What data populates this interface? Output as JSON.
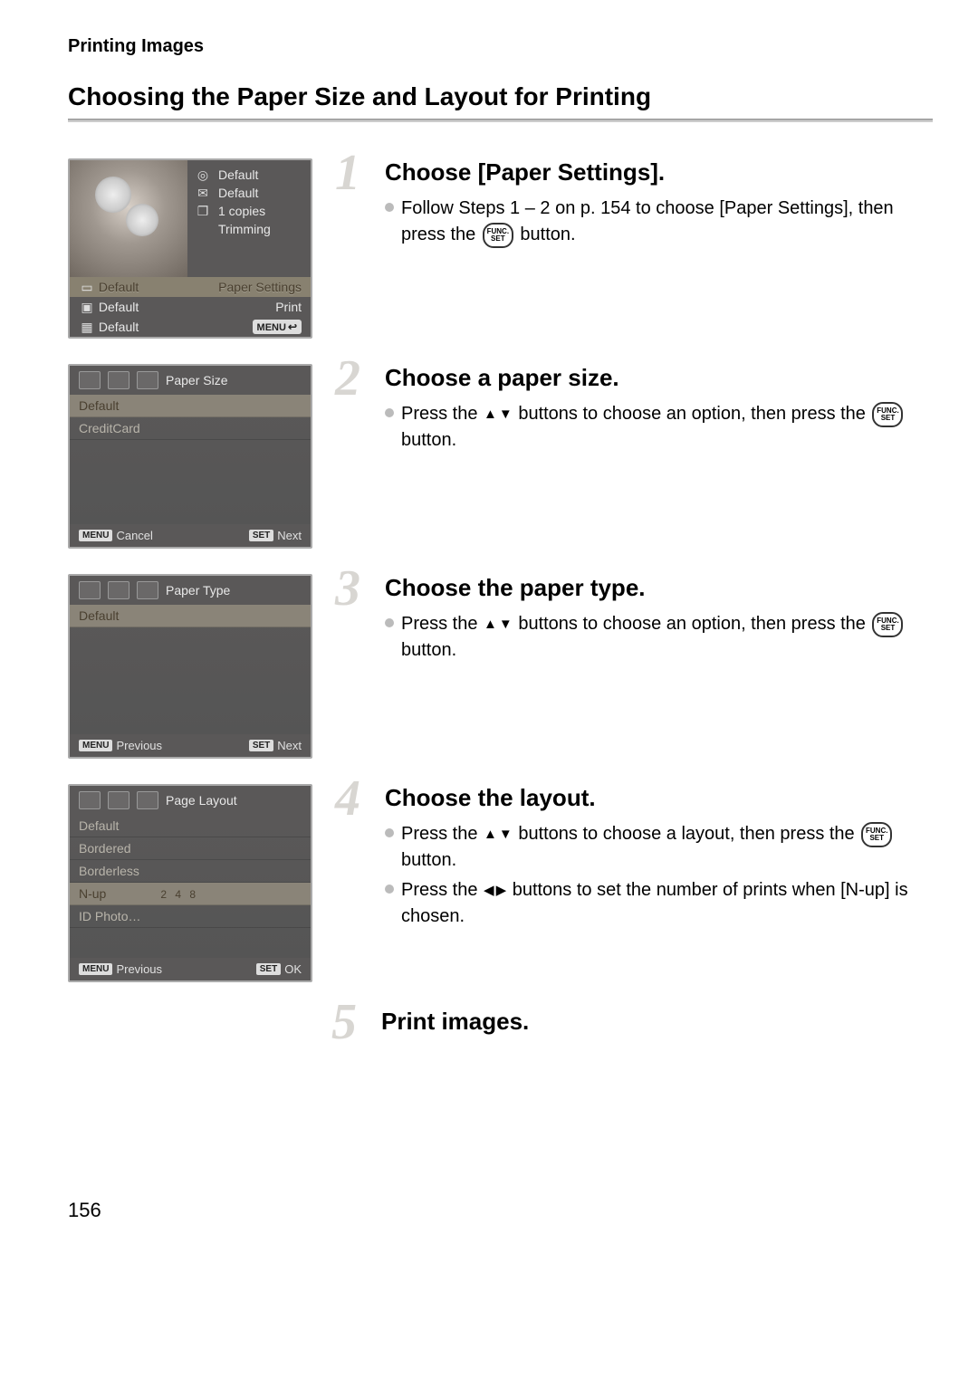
{
  "header_section": "Printing Images",
  "page_title": "Choosing the Paper Size and Layout for Printing",
  "page_number": "156",
  "screens": {
    "s1": {
      "right": [
        {
          "icon": "check-circle-icon",
          "label": "Default"
        },
        {
          "icon": "envelope-icon",
          "label": "Default"
        },
        {
          "icon": "copies-icon",
          "label": "1 copies"
        },
        {
          "icon": "",
          "label": "Trimming"
        }
      ],
      "bottom": [
        {
          "left_icon": "paper-icon",
          "left_label": "Default",
          "right_label": "Paper Settings",
          "highlight": true
        },
        {
          "left_icon": "printer-icon",
          "left_label": "Default",
          "right_label": "Print"
        },
        {
          "left_icon": "layout-icon",
          "left_label": "Default",
          "right_label": "MENU",
          "menu_badge": true
        }
      ]
    },
    "s2": {
      "title": "Paper Size",
      "items": [
        "Default",
        "CreditCard"
      ],
      "footer_left_badge": "MENU",
      "footer_left_label": "Cancel",
      "footer_right_badge": "SET",
      "footer_right_label": "Next"
    },
    "s3": {
      "title": "Paper Type",
      "items": [
        "Default"
      ],
      "footer_left_badge": "MENU",
      "footer_left_label": "Previous",
      "footer_right_badge": "SET",
      "footer_right_label": "Next"
    },
    "s4": {
      "title": "Page Layout",
      "items": [
        "Default",
        "Bordered",
        "Borderless",
        "N-up",
        "ID Photo…"
      ],
      "nup_numbers": "2 4 8",
      "selected_index": 3,
      "footer_left_badge": "MENU",
      "footer_left_label": "Previous",
      "footer_right_badge": "SET",
      "footer_right_label": "OK"
    }
  },
  "steps": {
    "step1": {
      "num": "1",
      "title": "Choose [Paper Settings].",
      "body_a": "Follow Steps 1 – 2 on p. 154 to choose [Paper Settings], then press the ",
      "body_b": " button.",
      "func_label": "FUNC.\nSET"
    },
    "step2": {
      "num": "2",
      "title": "Choose a paper size.",
      "body_a": "Press the ",
      "body_b": " buttons to choose an option, then press the ",
      "body_c": " button.",
      "func_label": "FUNC.\nSET"
    },
    "step3": {
      "num": "3",
      "title": "Choose the paper type.",
      "body_a": "Press the ",
      "body_b": " buttons to choose an option, then press the ",
      "body_c": " button.",
      "func_label": "FUNC.\nSET"
    },
    "step4": {
      "num": "4",
      "title": "Choose the layout.",
      "b1_a": "Press the ",
      "b1_b": " buttons to choose a layout, then press the ",
      "b1_c": " button.",
      "b2_a": "Press the ",
      "b2_b": " buttons to set the number of prints when [N-up] is chosen.",
      "func_label": "FUNC.\nSET"
    },
    "step5": {
      "num": "5",
      "title": "Print images."
    }
  }
}
